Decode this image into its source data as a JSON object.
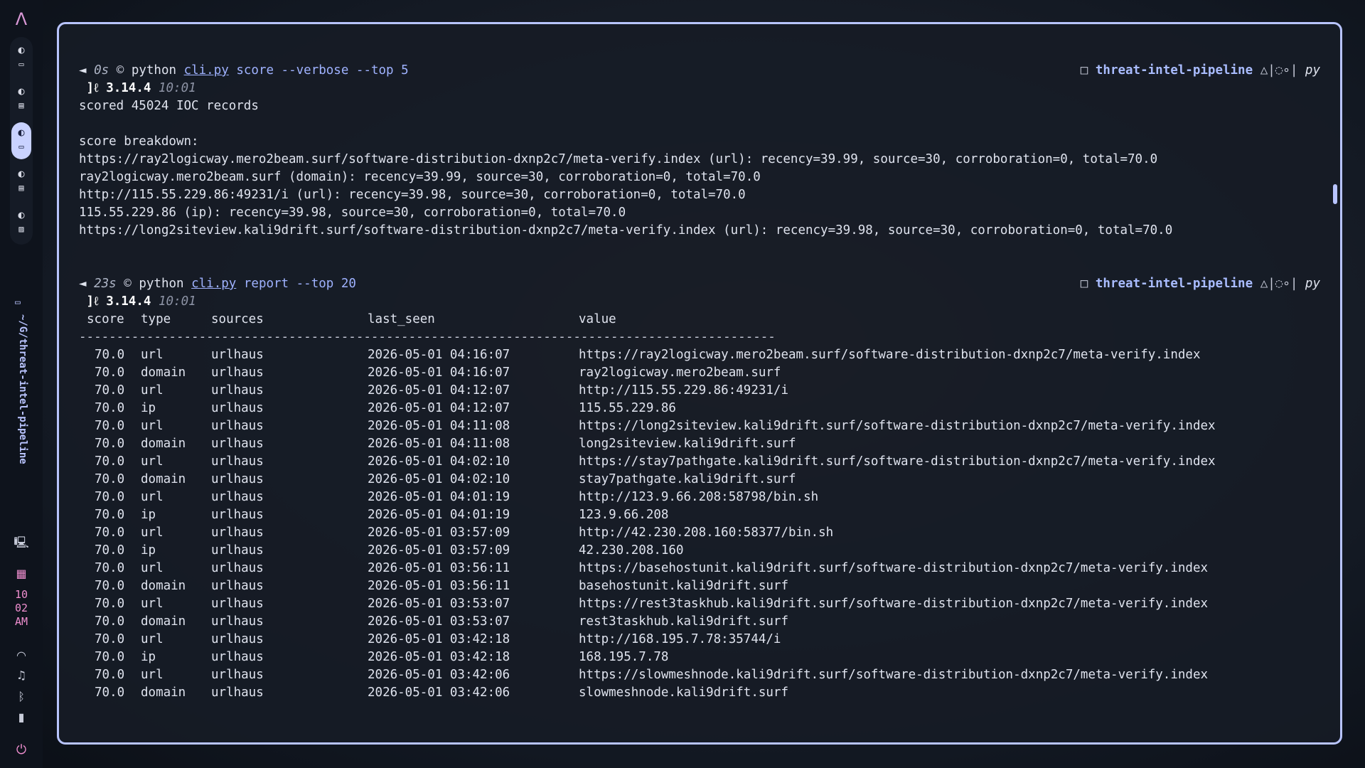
{
  "sidebar": {
    "logo_icon": "arch-logo-icon",
    "workspaces": [
      {
        "id": "1",
        "active": false
      },
      {
        "id": "2",
        "active": false
      },
      {
        "id": "3",
        "active": true
      },
      {
        "id": "4",
        "active": false
      },
      {
        "id": "5",
        "active": false
      }
    ],
    "path": "~/G/threat-intel-pipeline",
    "clock": {
      "hour": "10",
      "minute": "02",
      "ampm": "AM"
    },
    "colors": {
      "accent": "#b8c4ff",
      "pink": "#f08fd0"
    }
  },
  "terminal": {
    "block1": {
      "arrow": "◄",
      "duration": "0s",
      "shell_icon": "©",
      "cmd_prog": "python",
      "cmd_file": "cli.py",
      "cmd_args": "score --verbose --top 5",
      "py_prefix": "]ℓ",
      "py_version": "3.14.4",
      "time": "10:01",
      "right_box": "□",
      "project": "threat-intel-pipeline",
      "git_status": "△|◌∘|",
      "lang": "py",
      "output": [
        "scored 45024 IOC records",
        "",
        "score breakdown:",
        "https://ray2logicway.mero2beam.surf/software-distribution-dxnp2c7/meta-verify.index (url): recency=39.99, source=30, corroboration=0, total=70.0",
        "ray2logicway.mero2beam.surf (domain): recency=39.99, source=30, corroboration=0, total=70.0",
        "http://115.55.229.86:49231/i (url): recency=39.98, source=30, corroboration=0, total=70.0",
        "115.55.229.86 (ip): recency=39.98, source=30, corroboration=0, total=70.0",
        "https://long2siteview.kali9drift.surf/software-distribution-dxnp2c7/meta-verify.index (url): recency=39.98, source=30, corroboration=0, total=70.0"
      ]
    },
    "block2": {
      "arrow": "◄",
      "duration": "23s",
      "shell_icon": "©",
      "cmd_prog": "python",
      "cmd_file": "cli.py",
      "cmd_args": "report --top 20",
      "py_prefix": "]ℓ",
      "py_version": "3.14.4",
      "time": "10:01",
      "right_box": "□",
      "project": "threat-intel-pipeline",
      "git_status": "△|◌∘|",
      "lang": "py",
      "headers": {
        "score": "score",
        "type": "type",
        "sources": "sources",
        "last_seen": "last_seen",
        "value": "value"
      },
      "separator": "---------------------------------------------------------------------------------------------",
      "rows": [
        {
          "score": "70.0",
          "type": "url",
          "sources": "urlhaus",
          "last_seen": "2026-05-01 04:16:07",
          "value": "https://ray2logicway.mero2beam.surf/software-distribution-dxnp2c7/meta-verify.index"
        },
        {
          "score": "70.0",
          "type": "domain",
          "sources": "urlhaus",
          "last_seen": "2026-05-01 04:16:07",
          "value": "ray2logicway.mero2beam.surf"
        },
        {
          "score": "70.0",
          "type": "url",
          "sources": "urlhaus",
          "last_seen": "2026-05-01 04:12:07",
          "value": "http://115.55.229.86:49231/i"
        },
        {
          "score": "70.0",
          "type": "ip",
          "sources": "urlhaus",
          "last_seen": "2026-05-01 04:12:07",
          "value": "115.55.229.86"
        },
        {
          "score": "70.0",
          "type": "url",
          "sources": "urlhaus",
          "last_seen": "2026-05-01 04:11:08",
          "value": "https://long2siteview.kali9drift.surf/software-distribution-dxnp2c7/meta-verify.index"
        },
        {
          "score": "70.0",
          "type": "domain",
          "sources": "urlhaus",
          "last_seen": "2026-05-01 04:11:08",
          "value": "long2siteview.kali9drift.surf"
        },
        {
          "score": "70.0",
          "type": "url",
          "sources": "urlhaus",
          "last_seen": "2026-05-01 04:02:10",
          "value": "https://stay7pathgate.kali9drift.surf/software-distribution-dxnp2c7/meta-verify.index"
        },
        {
          "score": "70.0",
          "type": "domain",
          "sources": "urlhaus",
          "last_seen": "2026-05-01 04:02:10",
          "value": "stay7pathgate.kali9drift.surf"
        },
        {
          "score": "70.0",
          "type": "url",
          "sources": "urlhaus",
          "last_seen": "2026-05-01 04:01:19",
          "value": "http://123.9.66.208:58798/bin.sh"
        },
        {
          "score": "70.0",
          "type": "ip",
          "sources": "urlhaus",
          "last_seen": "2026-05-01 04:01:19",
          "value": "123.9.66.208"
        },
        {
          "score": "70.0",
          "type": "url",
          "sources": "urlhaus",
          "last_seen": "2026-05-01 03:57:09",
          "value": "http://42.230.208.160:58377/bin.sh"
        },
        {
          "score": "70.0",
          "type": "ip",
          "sources": "urlhaus",
          "last_seen": "2026-05-01 03:57:09",
          "value": "42.230.208.160"
        },
        {
          "score": "70.0",
          "type": "url",
          "sources": "urlhaus",
          "last_seen": "2026-05-01 03:56:11",
          "value": "https://basehostunit.kali9drift.surf/software-distribution-dxnp2c7/meta-verify.index"
        },
        {
          "score": "70.0",
          "type": "domain",
          "sources": "urlhaus",
          "last_seen": "2026-05-01 03:56:11",
          "value": "basehostunit.kali9drift.surf"
        },
        {
          "score": "70.0",
          "type": "url",
          "sources": "urlhaus",
          "last_seen": "2026-05-01 03:53:07",
          "value": "https://rest3taskhub.kali9drift.surf/software-distribution-dxnp2c7/meta-verify.index"
        },
        {
          "score": "70.0",
          "type": "domain",
          "sources": "urlhaus",
          "last_seen": "2026-05-01 03:53:07",
          "value": "rest3taskhub.kali9drift.surf"
        },
        {
          "score": "70.0",
          "type": "url",
          "sources": "urlhaus",
          "last_seen": "2026-05-01 03:42:18",
          "value": "http://168.195.7.78:35744/i"
        },
        {
          "score": "70.0",
          "type": "ip",
          "sources": "urlhaus",
          "last_seen": "2026-05-01 03:42:18",
          "value": "168.195.7.78"
        },
        {
          "score": "70.0",
          "type": "url",
          "sources": "urlhaus",
          "last_seen": "2026-05-01 03:42:06",
          "value": "https://slowmeshnode.kali9drift.surf/software-distribution-dxnp2c7/meta-verify.index"
        },
        {
          "score": "70.0",
          "type": "domain",
          "sources": "urlhaus",
          "last_seen": "2026-05-01 03:42:06",
          "value": "slowmeshnode.kali9drift.surf"
        }
      ]
    }
  }
}
